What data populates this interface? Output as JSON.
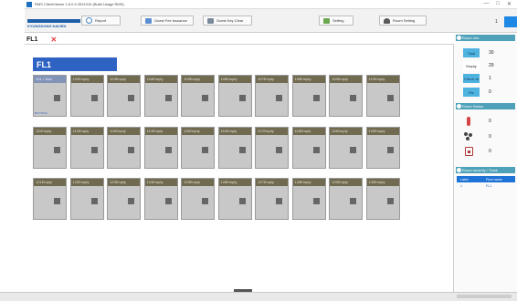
{
  "window": {
    "title": "RMS ClientViewer 1.6.0.9 2021010 (Build Usage RMS)",
    "controls": [
      "—",
      "□",
      "✕"
    ]
  },
  "toolbar": {
    "logo_text": "KYUNGDONG NAVIEN",
    "buttons": [
      {
        "label": "Report",
        "icon": "report-icon"
      },
      {
        "label": "Guest Fee Issuance",
        "icon": "issuance-icon"
      },
      {
        "label": "Guest Key Clear",
        "icon": "key-clear-icon"
      },
      {
        "label": "Setting",
        "icon": "setting-icon"
      },
      {
        "label": "Room Setting",
        "icon": "room-setting-icon"
      }
    ],
    "right_number": "1"
  },
  "tabs": [
    {
      "label": "FL1"
    }
  ],
  "floor": {
    "title": "FL1"
  },
  "rooms": [
    {
      "label": "101 / 1fan",
      "status": "occupied",
      "extra": "BOTTASU"
    },
    {
      "label": "102Empty",
      "status": "empty"
    },
    {
      "label": "103Empty",
      "status": "empty"
    },
    {
      "label": "104Empty",
      "status": "empty"
    },
    {
      "label": "105Empty",
      "status": "empty"
    },
    {
      "label": "106Empty",
      "status": "empty"
    },
    {
      "label": "107Empty",
      "status": "empty"
    },
    {
      "label": "108Empty",
      "status": "empty"
    },
    {
      "label": "109Empty",
      "status": "empty"
    },
    {
      "label": "110Empty",
      "status": "empty"
    },
    {
      "label": "111Empty",
      "status": "empty"
    },
    {
      "label": "112Empty",
      "status": "empty"
    },
    {
      "label": "113Empty",
      "status": "empty"
    },
    {
      "label": "114Empty",
      "status": "empty"
    },
    {
      "label": "115Empty",
      "status": "empty"
    },
    {
      "label": "116Empty",
      "status": "empty"
    },
    {
      "label": "117Empty",
      "status": "empty"
    },
    {
      "label": "118Empty",
      "status": "empty"
    },
    {
      "label": "119Empty",
      "status": "empty"
    },
    {
      "label": "120Empty",
      "status": "empty"
    },
    {
      "label": "121Empty",
      "status": "empty"
    },
    {
      "label": "122Empty",
      "status": "empty"
    },
    {
      "label": "123Empty",
      "status": "empty"
    },
    {
      "label": "124Empty",
      "status": "empty"
    },
    {
      "label": "125Empty",
      "status": "empty"
    },
    {
      "label": "126Empty",
      "status": "empty"
    },
    {
      "label": "127Empty",
      "status": "empty"
    },
    {
      "label": "128Empty",
      "status": "empty"
    },
    {
      "label": "129Empty",
      "status": "empty"
    },
    {
      "label": "130Empty",
      "status": "empty"
    }
  ],
  "sidebar": {
    "room_info": {
      "title": "Room Info",
      "stats": [
        {
          "label": "Total",
          "value": "30",
          "style": "filled"
        },
        {
          "label": "Empty",
          "value": "29",
          "style": "plain"
        },
        {
          "label": "Check-In",
          "value": "1",
          "style": "filled"
        },
        {
          "label": "Etc",
          "value": "0",
          "style": "filled"
        }
      ]
    },
    "room_status": {
      "title": "Room Status",
      "items": [
        {
          "icon": "thermometer-icon",
          "value": "0"
        },
        {
          "icon": "people-icon",
          "value": "0"
        },
        {
          "icon": "do-not-disturb-icon",
          "value": "0"
        }
      ]
    },
    "guest_table": {
      "title": "Room security / Track",
      "headers": [
        "Label",
        "Floor name"
      ],
      "rows": [
        [
          "1",
          "FL1"
        ]
      ]
    }
  },
  "colors": {
    "floor_bar": "#2f63c3",
    "room_header": "#6f6a50",
    "room_body": "#c8c8c8",
    "section_header": "#4ea1b9",
    "stat_fill": "#4fb3e0",
    "table_header": "#1f73d6",
    "tab_close": "#e53935"
  }
}
